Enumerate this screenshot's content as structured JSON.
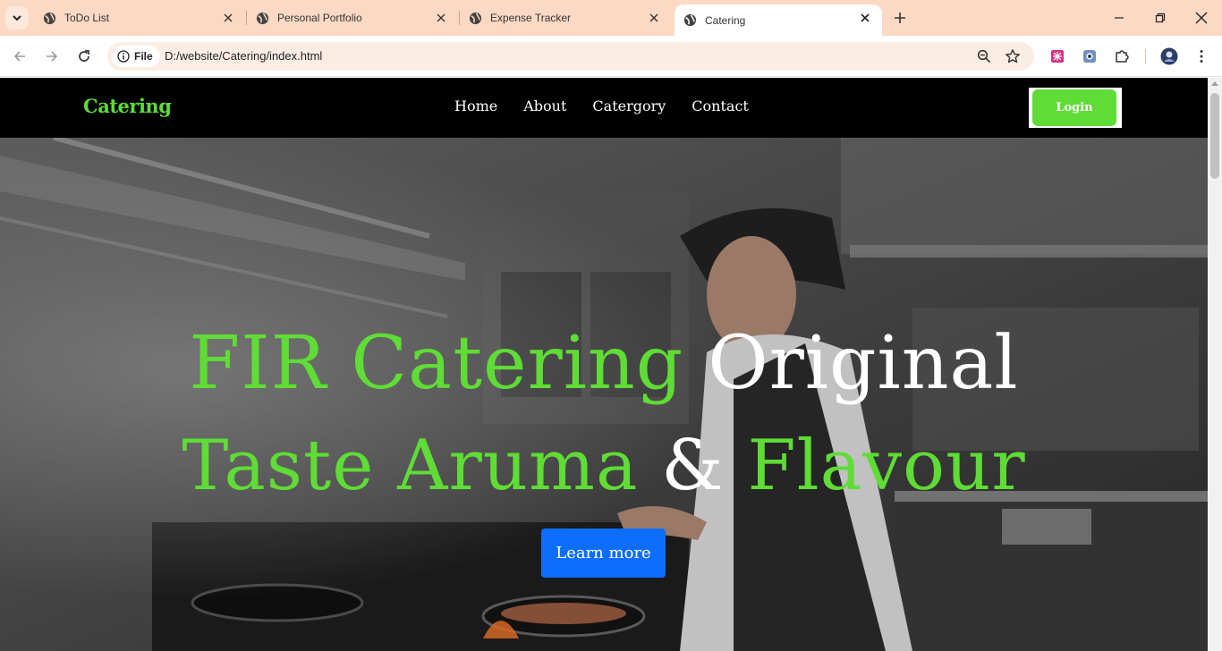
{
  "browser": {
    "tabs": [
      {
        "title": "ToDo List",
        "active": false
      },
      {
        "title": "Personal Portfolio",
        "active": false
      },
      {
        "title": "Expense Tracker",
        "active": false
      },
      {
        "title": "Catering",
        "active": true
      }
    ],
    "address": {
      "chip_label": "File",
      "url": "D:/website/Catering/index.html"
    },
    "colors": {
      "tabbar": "#fbd9c4",
      "omnibox": "#fcede4"
    }
  },
  "page": {
    "brand": "Catering",
    "nav": [
      "Home",
      "About",
      "Catergory",
      "Contact"
    ],
    "login_label": "Login",
    "hero": {
      "line1_green": "FIR Catering",
      "line1_white": "Original",
      "line2_green1": "Taste Aruma",
      "line2_white": "&",
      "line2_green2": "Flavour",
      "button_label": "Learn more"
    },
    "colors": {
      "accent": "#5fdc35",
      "button": "#0d6efd",
      "nav_bg": "#000000"
    }
  }
}
